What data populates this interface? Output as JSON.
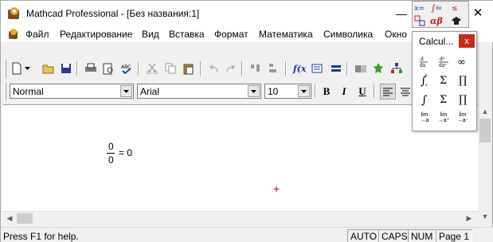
{
  "window": {
    "title": "Mathcad Professional - [Без названия:1]",
    "minimize": "—",
    "close": "✕"
  },
  "menu": {
    "items": [
      "Файл",
      "Редактирование",
      "Вид",
      "Вставка",
      "Формат",
      "Математика",
      "Символика",
      "Окно"
    ]
  },
  "format_toolbar": {
    "style": "Normal",
    "font": "Arial",
    "size": "10",
    "bold": "B",
    "italic": "I",
    "underline": "U"
  },
  "document": {
    "numerator": "0",
    "denominator": "0",
    "result": "= 0",
    "cursor": "+"
  },
  "status": {
    "help": "Press F1 for help.",
    "auto": "AUTO",
    "caps": "CAPS",
    "num": "NUM",
    "page": "Page 1"
  },
  "calculus_palette": {
    "title": "Calcul...",
    "close": "x",
    "cells": [
      "d/dx",
      "dⁿ/dxⁿ",
      "∞",
      "∫ₐᵇ",
      "Σ",
      "∏",
      "∫",
      "Σ",
      "∏",
      "lim",
      "lim",
      "lim"
    ]
  },
  "colors": {
    "cursor": "#d00000",
    "close_button": "#c42b1c"
  }
}
